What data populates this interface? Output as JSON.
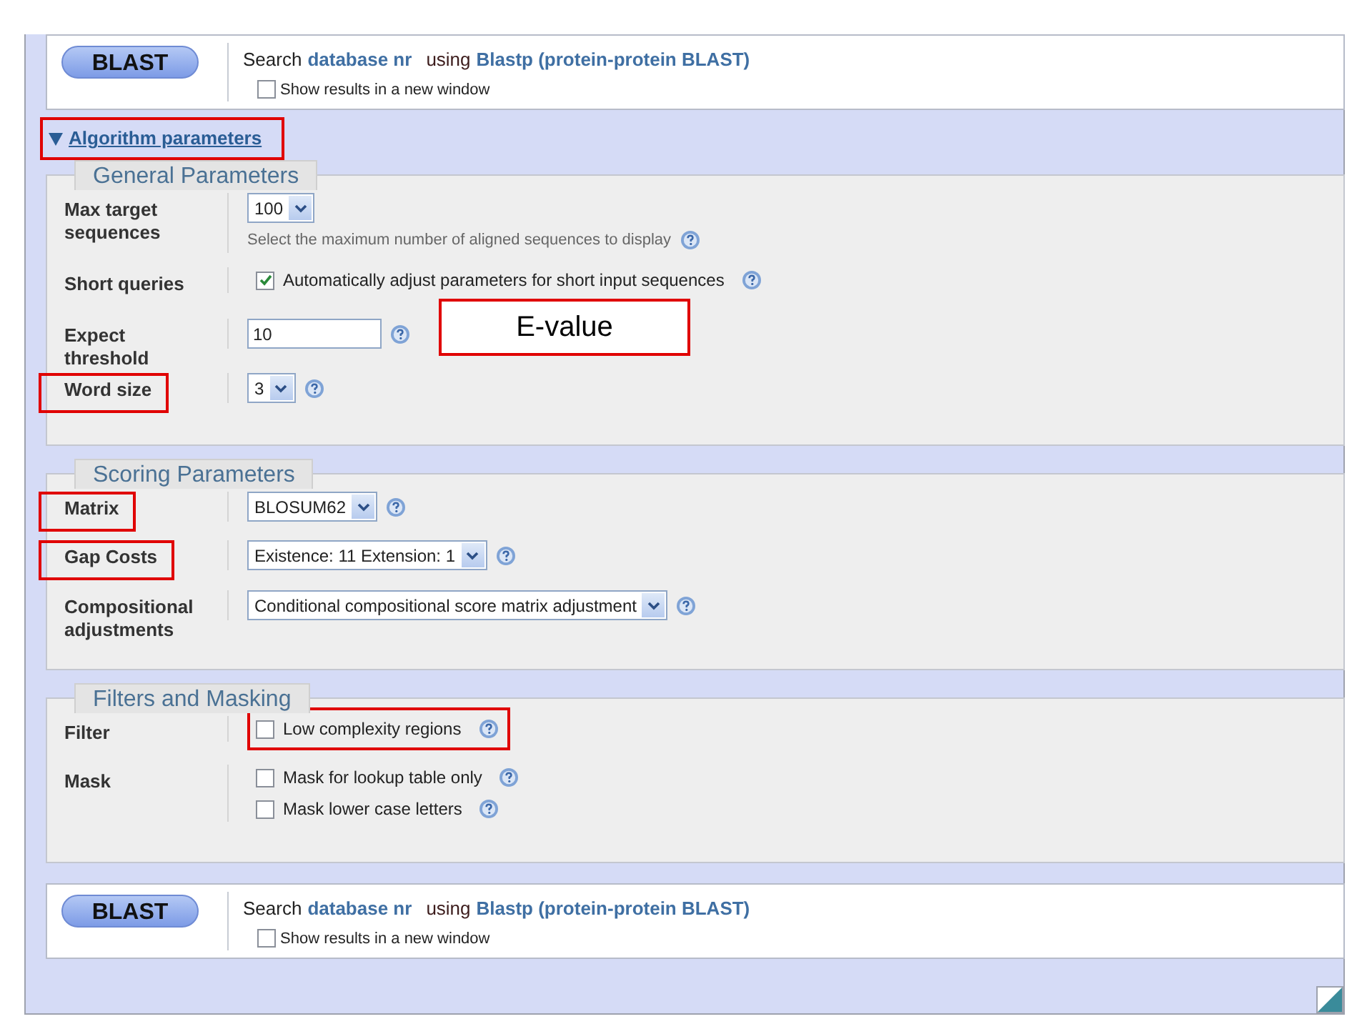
{
  "top_bar": {
    "button": "BLAST",
    "search_prefix": "Search",
    "database": "database nr",
    "using": "using",
    "program": "Blastp (protein-protein BLAST)",
    "new_window": {
      "label": "Show results in a new window",
      "checked": false
    }
  },
  "algorithm_toggle": {
    "label": "Algorithm parameters",
    "expanded": true,
    "highlighted": true
  },
  "sections": [
    {
      "title": "General Parameters",
      "rows": [
        {
          "label": "Max target sequences",
          "highlighted": false,
          "controls": [
            {
              "kind": "select",
              "value": "100",
              "help": false
            },
            {
              "kind": "hint",
              "text": "Select the maximum number of aligned sequences to display",
              "help": true
            }
          ]
        },
        {
          "label": "Short queries",
          "highlighted": false,
          "controls": [
            {
              "kind": "checkbox",
              "label": "Automatically adjust parameters for short input sequences",
              "checked": true,
              "help": true,
              "highlighted": false
            }
          ]
        },
        {
          "label": "Expect threshold",
          "highlighted": false,
          "controls": [
            {
              "kind": "text",
              "value": "10",
              "help": true
            }
          ],
          "callout": "E-value"
        },
        {
          "label": "Word size",
          "highlighted": true,
          "controls": [
            {
              "kind": "select",
              "value": "3",
              "help": true
            }
          ]
        }
      ]
    },
    {
      "title": "Scoring Parameters",
      "rows": [
        {
          "label": "Matrix",
          "highlighted": true,
          "controls": [
            {
              "kind": "select",
              "value": "BLOSUM62",
              "help": true
            }
          ]
        },
        {
          "label": "Gap Costs",
          "highlighted": true,
          "controls": [
            {
              "kind": "select",
              "value": "Existence: 11 Extension: 1",
              "help": true
            }
          ]
        },
        {
          "label": "Compositional adjustments",
          "highlighted": false,
          "controls": [
            {
              "kind": "select",
              "value": "Conditional compositional score matrix adjustment",
              "help": true
            }
          ]
        }
      ]
    },
    {
      "title": "Filters and Masking",
      "rows": [
        {
          "label": "Filter",
          "highlighted": false,
          "controls": [
            {
              "kind": "checkbox",
              "label": "Low complexity regions",
              "checked": false,
              "help": true,
              "highlighted": true
            }
          ]
        },
        {
          "label": "Mask",
          "highlighted": false,
          "controls": [
            {
              "kind": "checkbox",
              "label": "Mask for lookup table only",
              "checked": false,
              "help": true,
              "highlighted": false
            },
            {
              "kind": "checkbox",
              "label": "Mask lower case letters",
              "checked": false,
              "help": true,
              "highlighted": false
            }
          ]
        }
      ]
    }
  ],
  "bottom_bar": {
    "button": "BLAST",
    "search_prefix": "Search",
    "database": "database nr",
    "using": "using",
    "program": "Blastp (protein-protein BLAST)",
    "new_window": {
      "label": "Show results in a new window",
      "checked": false
    }
  }
}
